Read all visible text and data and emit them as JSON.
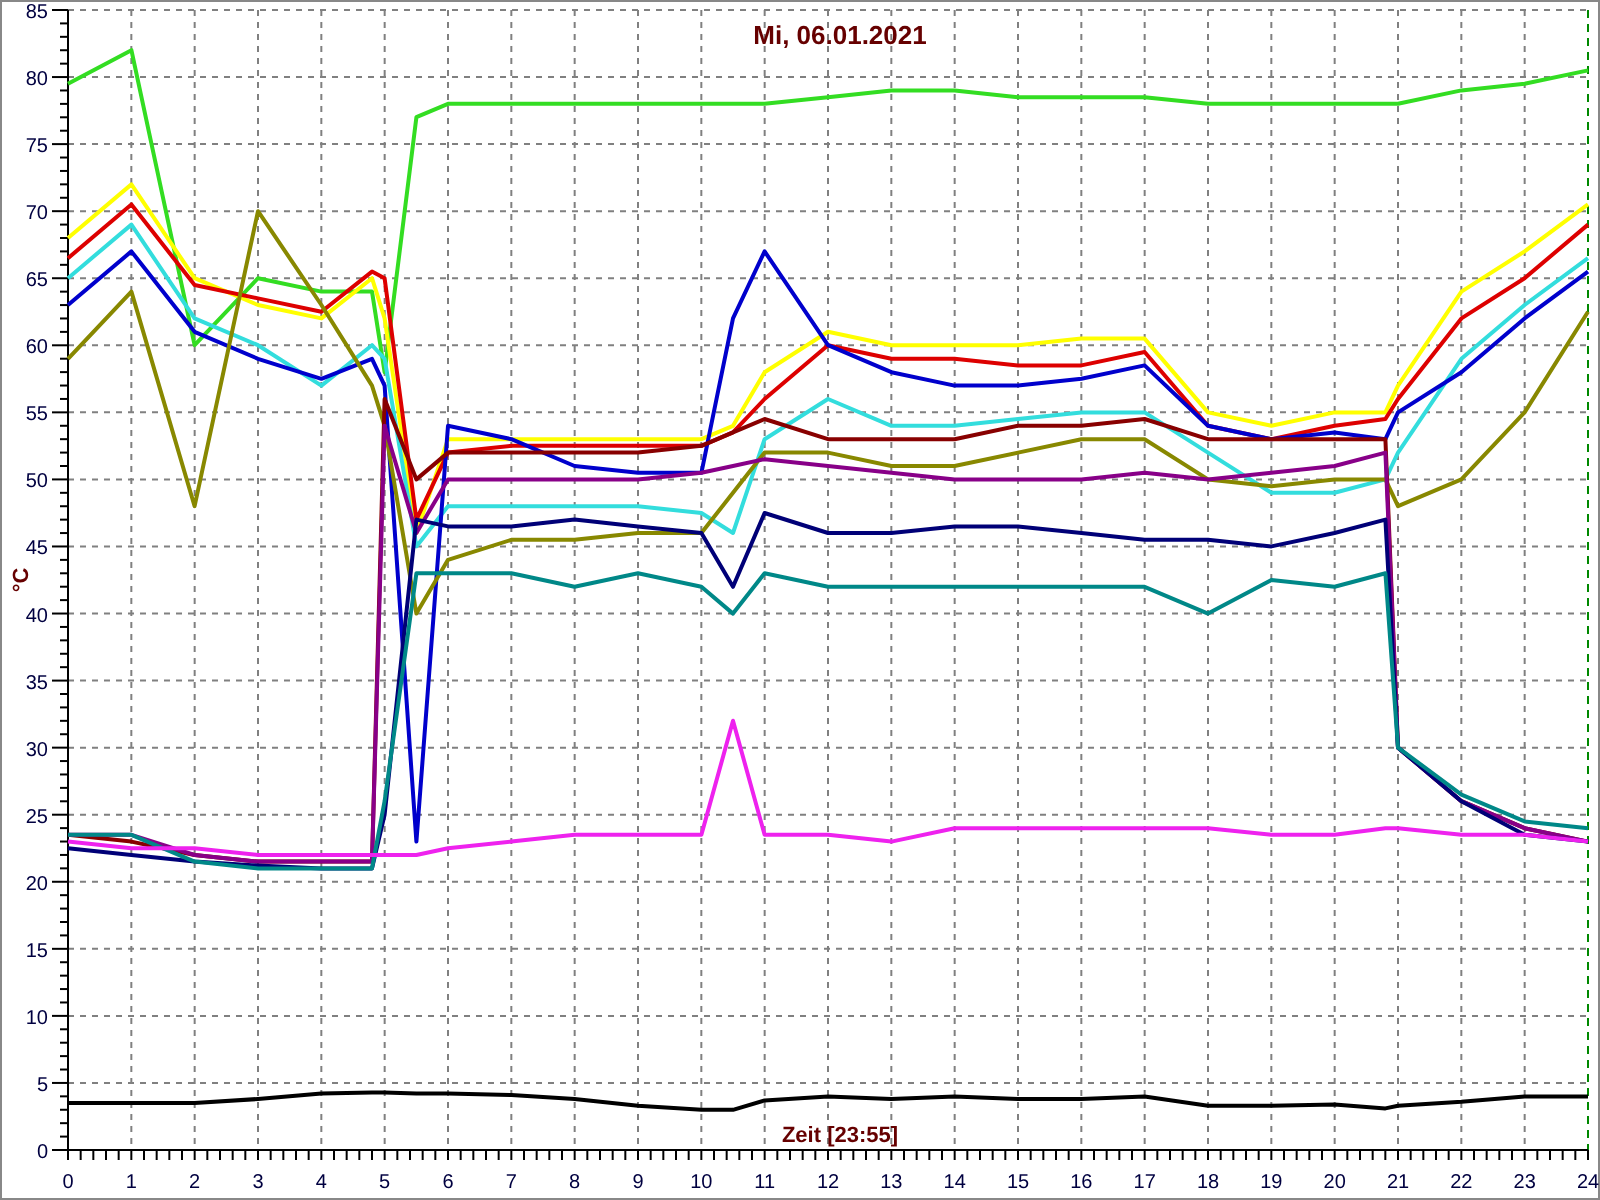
{
  "chart": {
    "chart_data": {
      "type": "line",
      "title": "Mi, 06.01.2021",
      "xlabel": "Zeit [23:55]",
      "ylabel": "°C",
      "x": [
        0,
        1,
        2,
        3,
        4,
        4.8,
        5,
        5.5,
        6,
        7,
        8,
        9,
        10,
        10.5,
        11,
        12,
        13,
        14,
        15,
        16,
        17,
        18,
        19,
        20,
        20.8,
        21,
        22,
        23,
        24
      ],
      "series": [
        {
          "color": "#33dd22",
          "values": [
            79.5,
            82,
            60,
            65,
            64,
            64,
            58,
            77,
            78,
            78,
            78,
            78,
            78,
            78,
            78,
            78.5,
            79,
            79,
            78.5,
            78.5,
            78.5,
            78,
            78,
            78,
            78,
            78,
            79,
            79.5,
            80.5
          ]
        },
        {
          "color": "#ffff00",
          "values": [
            68,
            72,
            65,
            63,
            62,
            65,
            62,
            46,
            53,
            53,
            53,
            53,
            53,
            54,
            58,
            61,
            60,
            60,
            60,
            60.5,
            60.5,
            55,
            54,
            55,
            55,
            57,
            64,
            67,
            70.5
          ]
        },
        {
          "color": "#dd0000",
          "values": [
            66.5,
            70.5,
            64.5,
            63.5,
            62.5,
            65.5,
            65,
            47,
            52,
            52.5,
            52.5,
            52.5,
            52.5,
            53.5,
            56,
            60,
            59,
            59,
            58.5,
            58.5,
            59.5,
            54,
            53,
            54,
            54.5,
            56,
            62,
            65,
            69
          ]
        },
        {
          "color": "#33dddd",
          "values": [
            65,
            69,
            62,
            60,
            57,
            60,
            59,
            45,
            48,
            48,
            48,
            48,
            47.5,
            46,
            53,
            56,
            54,
            54,
            54.5,
            55,
            55,
            52,
            49,
            49,
            50,
            52,
            59,
            63,
            66.5
          ]
        },
        {
          "color": "#0000cc",
          "values": [
            63,
            67,
            61,
            59,
            57.5,
            59,
            57,
            23,
            54,
            53,
            51,
            50.5,
            50.5,
            62,
            67,
            60,
            58,
            57,
            57,
            57.5,
            58.5,
            54,
            53,
            53.5,
            53,
            55,
            58,
            62,
            65.5
          ]
        },
        {
          "color": "#888800",
          "values": [
            59,
            64,
            48,
            70,
            63,
            57,
            54,
            40,
            44,
            45.5,
            45.5,
            46,
            46,
            49,
            52,
            52,
            51,
            51,
            52,
            53,
            53,
            50,
            49.5,
            50,
            50,
            48,
            50,
            55,
            62.5
          ]
        },
        {
          "color": "#880000",
          "values": [
            23.5,
            23,
            22,
            21.5,
            21.5,
            21.5,
            56,
            50,
            52,
            52,
            52,
            52,
            52.5,
            53.5,
            54.5,
            53,
            53,
            53,
            54,
            54,
            54.5,
            53,
            53,
            53,
            53,
            30,
            26,
            24,
            23
          ]
        },
        {
          "color": "#880088",
          "values": [
            23.5,
            23.5,
            22,
            21.5,
            21.5,
            21.5,
            54,
            46,
            50,
            50,
            50,
            50,
            50.5,
            51,
            51.5,
            51,
            50.5,
            50,
            50,
            50,
            50.5,
            50,
            50.5,
            51,
            52,
            30,
            26,
            24,
            23
          ]
        },
        {
          "color": "#000077",
          "values": [
            22.5,
            22,
            21.5,
            21.2,
            21,
            21,
            25,
            47,
            46.5,
            46.5,
            47,
            46.5,
            46,
            42,
            47.5,
            46,
            46,
            46.5,
            46.5,
            46,
            45.5,
            45.5,
            45,
            46,
            47,
            30,
            26,
            23.5,
            23
          ]
        },
        {
          "color": "#008888",
          "values": [
            23.5,
            23.5,
            21.5,
            21,
            21,
            21,
            26,
            43,
            43,
            43,
            42,
            43,
            42,
            40,
            43,
            42,
            42,
            42,
            42,
            42,
            42,
            40,
            42.5,
            42,
            43,
            30,
            26.5,
            24.5,
            24
          ]
        },
        {
          "color": "#ee22ee",
          "values": [
            23,
            22.5,
            22.5,
            22,
            22,
            22,
            22,
            22,
            22.5,
            23,
            23.5,
            23.5,
            23.5,
            32,
            23.5,
            23.5,
            23,
            24,
            24,
            24,
            24,
            24,
            23.5,
            23.5,
            24,
            24,
            23.5,
            23.5,
            23
          ]
        },
        {
          "color": "#000000",
          "values": [
            3.5,
            3.5,
            3.5,
            3.8,
            4.2,
            4.3,
            4.3,
            4.2,
            4.2,
            4.1,
            3.8,
            3.3,
            3,
            3,
            3.7,
            4,
            3.8,
            4,
            3.8,
            3.8,
            4,
            3.3,
            3.3,
            3.4,
            3.1,
            3.3,
            3.6,
            4,
            4
          ]
        }
      ],
      "grid": true,
      "xlim": [
        0,
        24
      ],
      "ylim": [
        0,
        85
      ],
      "xticks": [
        0,
        1,
        2,
        3,
        4,
        5,
        6,
        7,
        8,
        9,
        10,
        11,
        12,
        13,
        14,
        15,
        16,
        17,
        18,
        19,
        20,
        21,
        22,
        23,
        24
      ],
      "yticks": [
        0,
        5,
        10,
        15,
        20,
        25,
        30,
        35,
        40,
        45,
        50,
        55,
        60,
        65,
        70,
        75,
        80,
        85
      ]
    }
  }
}
